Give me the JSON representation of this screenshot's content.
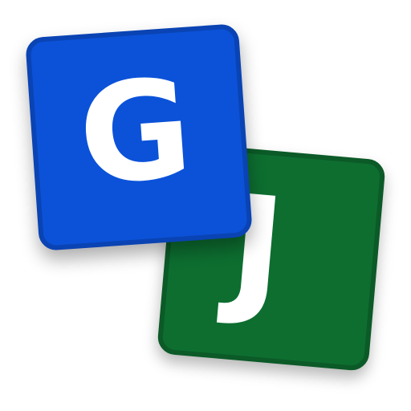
{
  "tiles": {
    "back": {
      "letter": "J",
      "color": "#0d6e30",
      "border_color": "#0b5a27"
    },
    "front": {
      "letter": "G",
      "color": "#0b52d8",
      "border_color": "#0a43b3"
    }
  },
  "letter_color": "#ffffff"
}
